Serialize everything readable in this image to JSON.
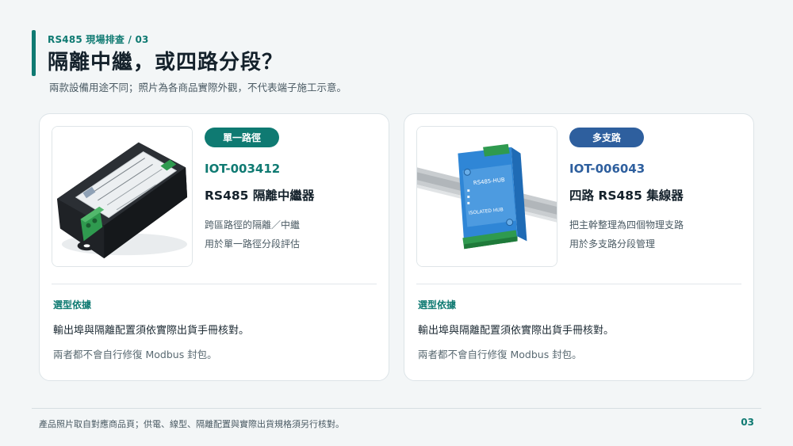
{
  "header": {
    "eyebrow": "RS485 現場排查 / 03",
    "title": "隔離中繼，或四路分段？",
    "subtitle": "兩款設備用途不同；照片為各商品實際外觀，不代表端子施工示意。"
  },
  "cards": [
    {
      "tag": "單一路徑",
      "code": "IOT-003412",
      "name": "RS485 隔離中繼器",
      "desc": [
        "跨區路徑的隔離／中繼",
        "用於單一路徑分段評估"
      ],
      "selection_label": "選型依據",
      "selection_lines": [
        "輸出埠與隔離配置須依實際出貨手冊核對。",
        "兩者都不會自行修復 Modbus 封包。"
      ],
      "accent": "#0f7a72"
    },
    {
      "tag": "多支路",
      "code": "IOT-006043",
      "name": "四路 RS485 集線器",
      "desc": [
        "把主幹整理為四個物理支路",
        "用於多支路分段管理"
      ],
      "selection_label": "選型依據",
      "selection_lines": [
        "輸出埠與隔離配置須依實際出貨手冊核對。",
        "兩者都不會自行修復 Modbus 封包。"
      ],
      "accent": "#2e5f9e"
    }
  ],
  "footer": {
    "note": "產品照片取自對應商品頁；供電、線型、隔離配置與實際出貨規格須另行核對。",
    "page": "03"
  }
}
